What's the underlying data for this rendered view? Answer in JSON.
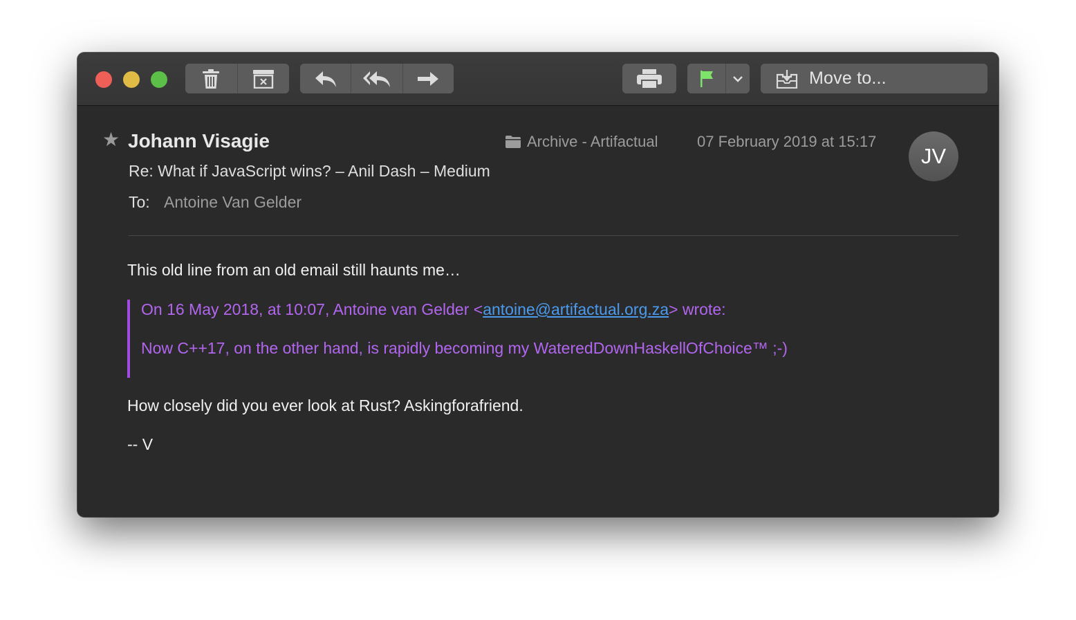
{
  "toolbar": {
    "delete_icon": "trash-icon",
    "junk_icon": "junk-icon",
    "reply_icon": "reply-icon",
    "reply_all_icon": "reply-all-icon",
    "forward_icon": "forward-icon",
    "print_icon": "print-icon",
    "flag_icon": "flag-icon",
    "flag_color": "#7ee36a",
    "move_label": "Move to..."
  },
  "message": {
    "sender": "Johann Visagie",
    "subject": "Re: What if JavaScript wins? – Anil Dash – Medium",
    "to_label": "To:",
    "to_value": "Antoine Van Gelder",
    "mailbox": "Archive - Artifactual",
    "date": "07 February 2019 at 15:17",
    "avatar_initials": "JV"
  },
  "body": {
    "line1": "This old line from an old email still haunts me…",
    "quote_prefix": "On 16 May 2018, at 10:07, Antoine van Gelder <",
    "quote_email": "antoine@artifactual.org.za",
    "quote_suffix": "> wrote:",
    "quote_line2": "Now C++17, on the other hand, is rapidly becoming my WateredDownHaskellOfChoice™ ;-)",
    "line2": "How closely did you ever look at Rust?  Askingforafriend.",
    "signature": "-- V"
  },
  "colors": {
    "quote": "#b266ef",
    "quote_bar": "#a14be0",
    "link": "#4b9aed",
    "background": "#2a2a2a"
  }
}
